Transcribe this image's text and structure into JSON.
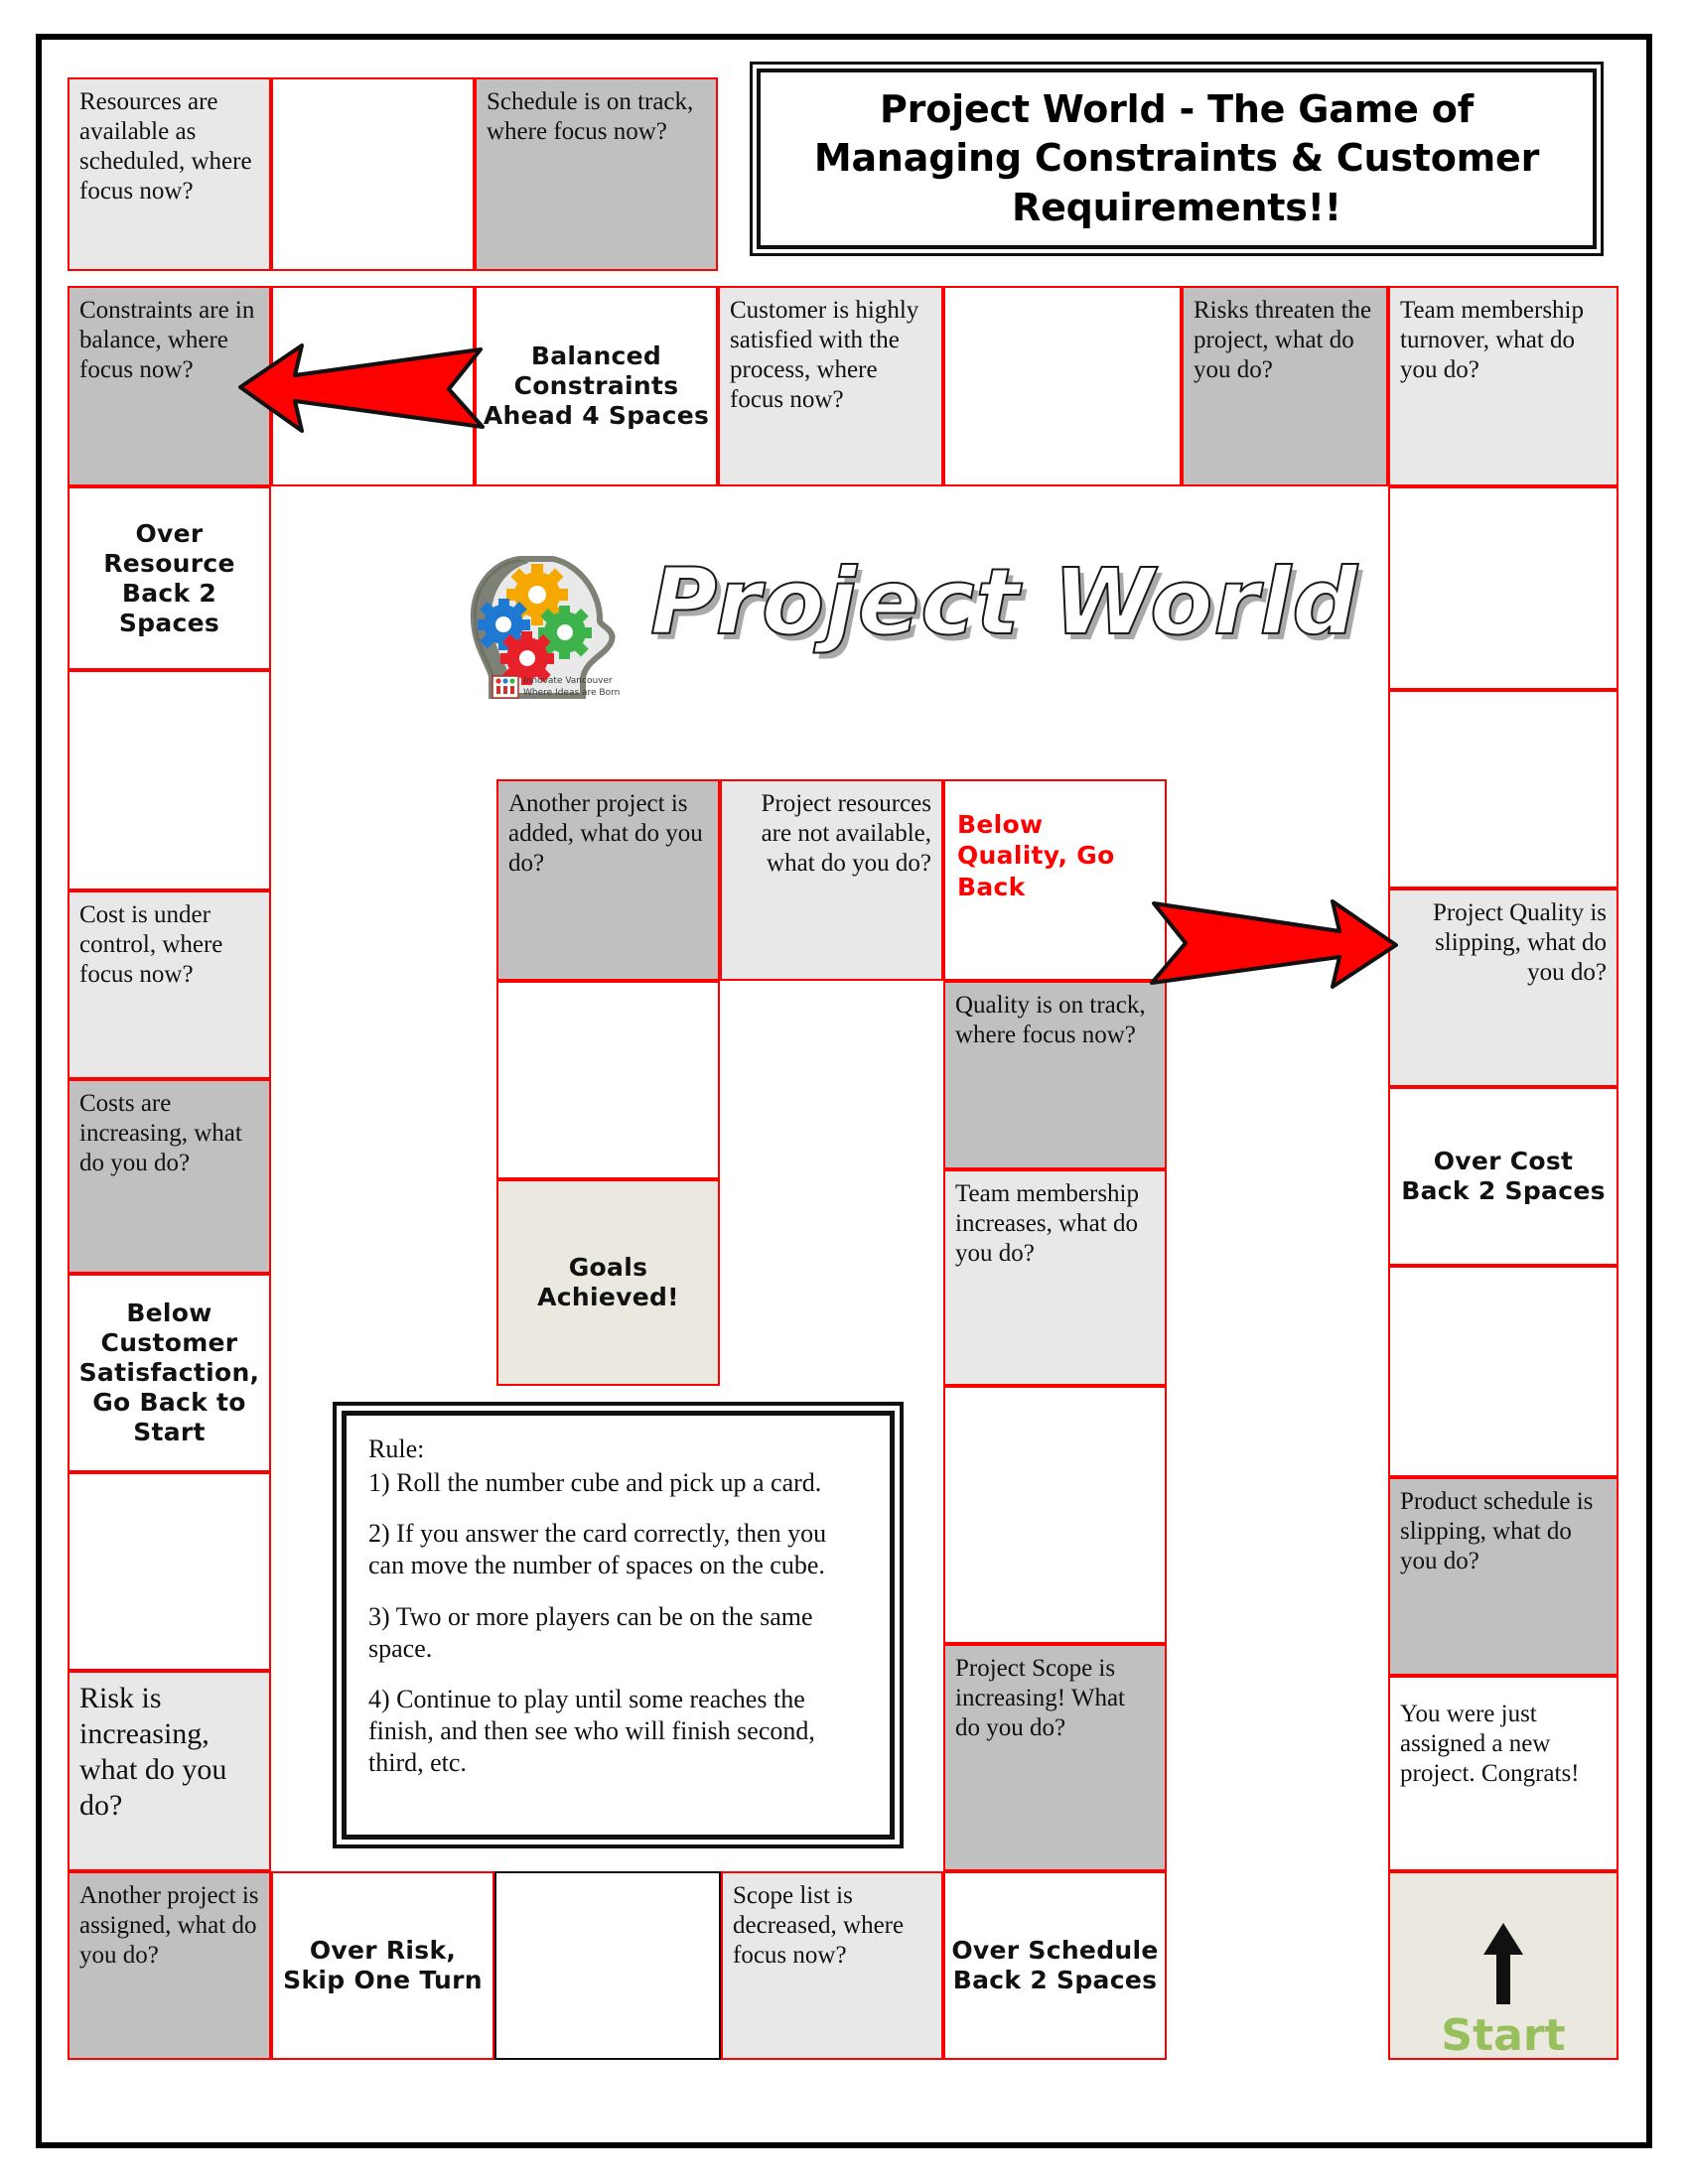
{
  "title": {
    "text": "Project World - The Game of Managing Constraints & Customer Requirements!!"
  },
  "logo": {
    "wordmark": "Project World",
    "badge_line1": "Innovate Vancouver",
    "badge_line2": "Where Ideas are Born",
    "gear_colors": [
      "#f5a800",
      "#1f78d1",
      "#3cb44b",
      "#e8202a"
    ],
    "head_color": "#6b6f62"
  },
  "colors": {
    "space_border": "#ff0000",
    "fill_dark": "#c0c0c0",
    "fill_light": "#e8e8e8",
    "fill_white": "#ffffff",
    "fill_cream": "#ebe8e0",
    "action_red": "#ff0000",
    "action_green": "#97c05c",
    "arrow_red": "#ff0000",
    "frame_black": "#000000"
  },
  "rules": {
    "heading": "Rule:",
    "items": [
      "1) Roll the number cube and pick up a card.",
      "2) If you answer the card correctly, then you can move the number of spaces on the cube.",
      "3) Two or more players can be on the same space.",
      "4) Continue to play until some reaches the finish, and then see who will finish second, third, etc."
    ]
  },
  "arrows": [
    {
      "name": "balanced-constraints-arrow",
      "direction": "left"
    },
    {
      "name": "below-quality-arrow",
      "direction": "right"
    }
  ],
  "spaces": {
    "top_row": {
      "resources_available": "Resources are available as scheduled, where focus now?",
      "blank_1": "",
      "schedule_on_track": "Schedule is on track, where focus now?"
    },
    "second_row": {
      "constraints_in_balance": "Constraints are in balance, where focus now?",
      "blank_2": "",
      "balanced_constraints": "Balanced Constraints Ahead 4 Spaces",
      "customer_satisfied": "Customer is highly satisfied with the process, where focus now?",
      "blank_3": "",
      "risks_threaten": "Risks threaten the project, what do you do?",
      "team_turnover": "Team membership turnover, what do you do?"
    },
    "left_column": {
      "over_resource": "Over Resource Back 2 Spaces",
      "blank_4": "",
      "cost_under_control": "Cost is under control, where focus now?",
      "costs_increasing": "Costs are increasing, what do you do?",
      "below_customer_satisfaction": "Below Customer Satisfaction, Go Back to Start",
      "blank_5": "",
      "risk_increasing": "Risk is increasing, what do you do?"
    },
    "inner_left_column": {
      "another_project_added": "Another project is added, what do you do?",
      "blank_6": "",
      "goals_achieved": "Goals Achieved!"
    },
    "inner_middle": {
      "project_resources_unavailable": "Project resources are not available, what do you do?"
    },
    "inner_right_column": {
      "below_quality": "Below Quality, Go Back",
      "quality_on_track": "Quality is on track, where focus now?",
      "team_increases": "Team membership increases, what do you do?",
      "blank_7": "",
      "project_scope_increasing": "Project Scope is increasing! What do you do?"
    },
    "right_column": {
      "blank_8": "",
      "blank_9": "",
      "project_quality_slipping": "Project Quality is slipping, what do you do?",
      "over_cost": "Over Cost Back 2 Spaces",
      "blank_10": "",
      "product_schedule_slipping": "Product schedule is slipping, what do you do?",
      "new_project_congrats": "You were just assigned a new project. Congrats!",
      "start": "Start"
    },
    "bottom_row": {
      "another_project_assigned": "Another project is assigned, what do you do?",
      "over_risk": "Over Risk, Skip One Turn",
      "blank_11": "",
      "scope_decreased": "Scope list is decreased, where focus now?",
      "over_schedule": "Over Schedule Back 2 Spaces"
    }
  }
}
